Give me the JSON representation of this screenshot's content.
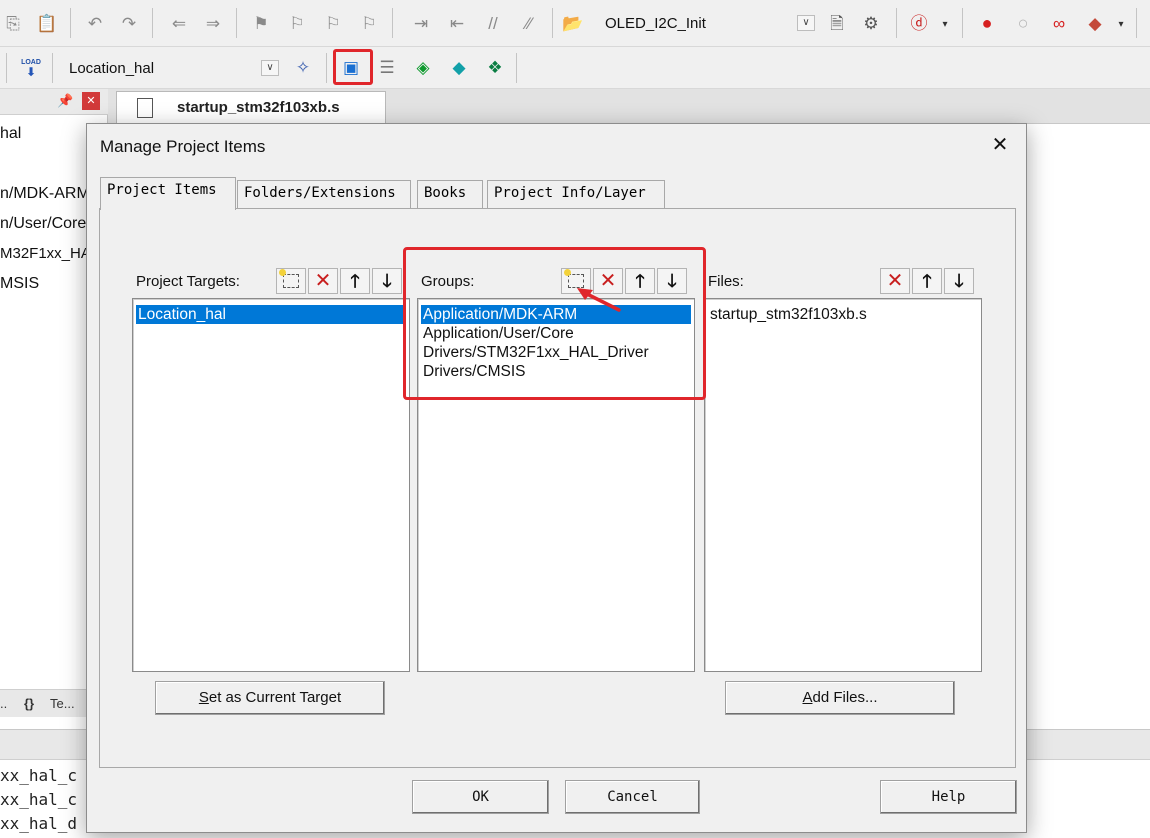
{
  "toolbar": {
    "project_combo_value": "OLED_I2C_Init",
    "target_combo_value": "Location_hal",
    "load_label": "LOAD"
  },
  "left_panel": {
    "tree_items": [
      "hal",
      "n/MDK-ARM",
      "n/User/Core",
      "M32F1xx_HAL",
      "MSIS"
    ],
    "bottom_tabs": [
      "..",
      "{}",
      "Te..."
    ]
  },
  "editor": {
    "active_tab": "startup_stm32f103xb.s"
  },
  "output": {
    "lines": [
      "xx_hal_c",
      "xx_hal_c",
      "xx_hal_d"
    ]
  },
  "dialog": {
    "title": "Manage Project Items",
    "tabs": [
      "Project Items",
      "Folders/Extensions",
      "Books",
      "Project Info/Layer"
    ],
    "targets": {
      "label": "Project Targets:",
      "items": [
        "Location_hal"
      ],
      "selected": "Location_hal"
    },
    "groups": {
      "label": "Groups:",
      "items": [
        "Application/MDK-ARM",
        "Application/User/Core",
        "Drivers/STM32F1xx_HAL_Driver",
        "Drivers/CMSIS"
      ],
      "selected": "Application/MDK-ARM"
    },
    "files": {
      "label": "Files:",
      "items": [
        "startup_stm32f103xb.s"
      ]
    },
    "buttons": {
      "set_current_target_u": "S",
      "set_current_target_rest": "et as Current Target",
      "add_files_u": "A",
      "add_files_rest": "dd Files...",
      "ok": "OK",
      "cancel": "Cancel",
      "help": "Help"
    }
  },
  "colors": {
    "selection": "#0078d7",
    "highlight_annotation": "#e0262b"
  }
}
